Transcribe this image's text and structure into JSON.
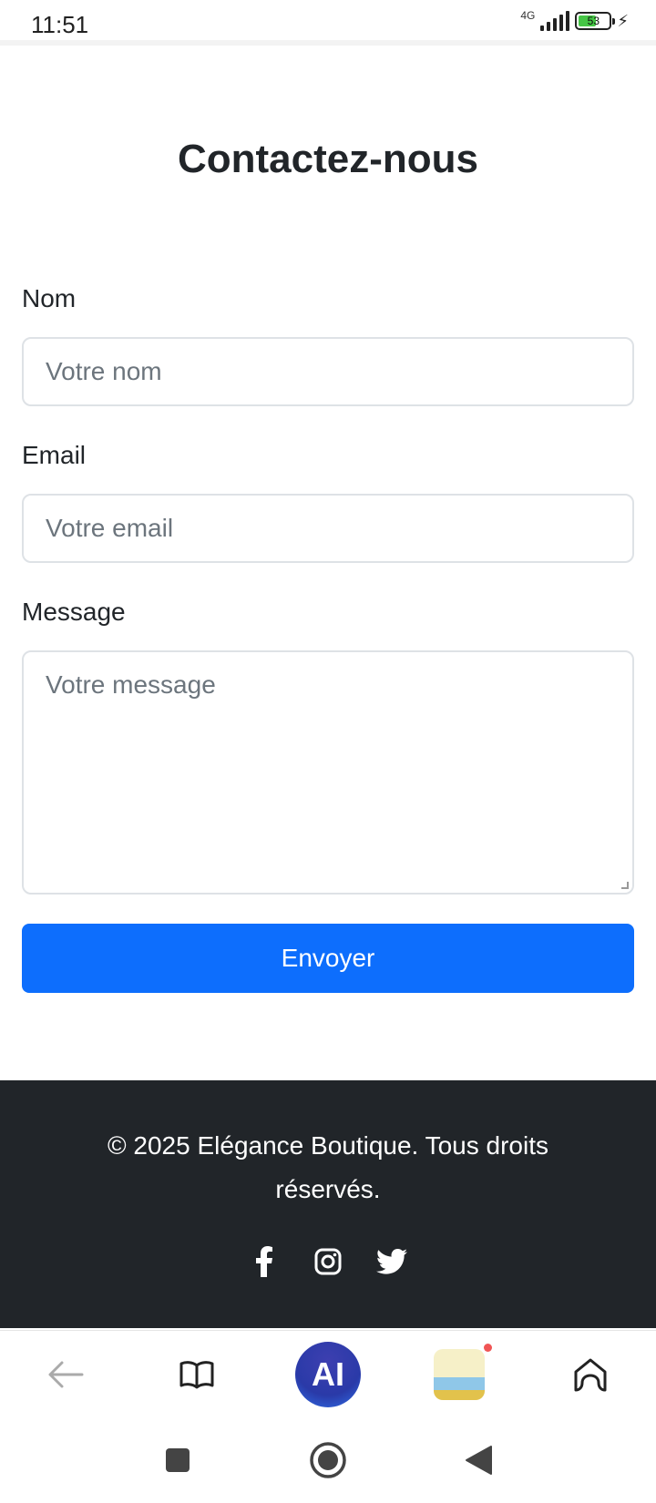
{
  "status_bar": {
    "time": "11:51",
    "network": "4G",
    "battery": "53"
  },
  "page": {
    "title": "Contactez-nous"
  },
  "form": {
    "name_label": "Nom",
    "name_placeholder": "Votre nom",
    "email_label": "Email",
    "email_placeholder": "Votre email",
    "message_label": "Message",
    "message_placeholder": "Votre message",
    "submit_label": "Envoyer"
  },
  "footer": {
    "copyright": "© 2025 Elégance Boutique. Tous droits réservés.",
    "social": [
      "facebook-icon",
      "instagram-icon",
      "twitter-icon"
    ]
  },
  "browser_nav": {
    "items": [
      "back-arrow-icon",
      "book-icon",
      "ai-assistant",
      "game-shortcut",
      "home-icon"
    ],
    "ai_label": "AI"
  },
  "system_nav": {
    "items": [
      "recents-square-icon",
      "home-circle-icon",
      "back-triangle-icon"
    ]
  },
  "colors": {
    "primary": "#0d6efd",
    "footer_bg": "#212529",
    "text": "#212529",
    "placeholder": "#6c757d",
    "border": "#dee2e6"
  }
}
